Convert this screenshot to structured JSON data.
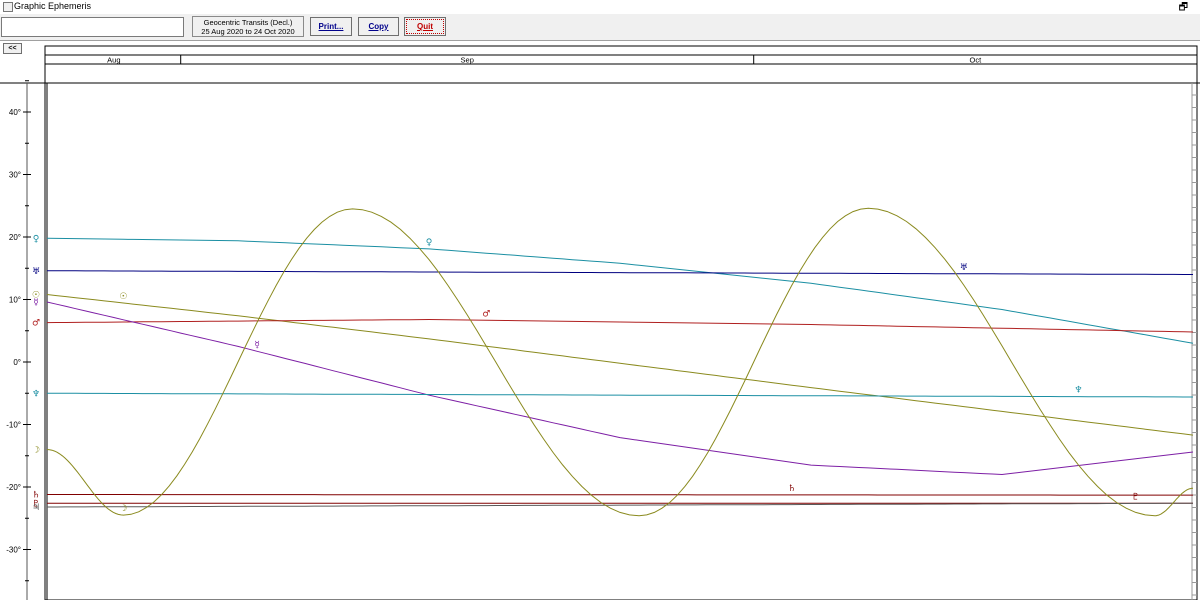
{
  "window": {
    "title": "Graphic Ephemeris"
  },
  "toolbar": {
    "field_value": "",
    "chart_desc_line1": "Geocentric Transits (Decl.)",
    "chart_desc_line2": "25 Aug 2020 to 24 Oct 2020",
    "print_label": "Print...",
    "copy_label": "Copy",
    "quit_label": "Quit",
    "back_label": "<<"
  },
  "chart_data": {
    "type": "line",
    "title": "Geocentric Transits (Decl.)",
    "x_range": [
      "2020-08-25",
      "2020-10-24"
    ],
    "months": [
      "Aug",
      "Sep",
      "Oct"
    ],
    "ylim": [
      -37,
      45
    ],
    "y_ticks": [
      {
        "value": 40,
        "label": "40°"
      },
      {
        "value": 30,
        "label": "30°"
      },
      {
        "value": 20,
        "label": "20°"
      },
      {
        "value": 10,
        "label": "10°"
      },
      {
        "value": 0,
        "label": "0°"
      },
      {
        "value": -10,
        "label": "-10°"
      },
      {
        "value": -20,
        "label": "-20°"
      },
      {
        "value": -30,
        "label": "-30°"
      }
    ],
    "grid": false,
    "series": [
      {
        "name": "Venus",
        "glyph": "♀",
        "color": "#1b8fa3",
        "x": [
          "2020-08-25",
          "2020-09-04",
          "2020-09-14",
          "2020-09-24",
          "2020-10-04",
          "2020-10-14",
          "2020-10-24"
        ],
        "y": [
          19.8,
          19.4,
          18.1,
          15.8,
          12.6,
          8.4,
          3.0
        ]
      },
      {
        "name": "Uranus",
        "glyph": "♅",
        "color": "#000080",
        "x": [
          "2020-08-25",
          "2020-10-24"
        ],
        "y": [
          14.6,
          14.0
        ]
      },
      {
        "name": "Sun",
        "glyph": "☉",
        "color": "#8a8a1e",
        "x": [
          "2020-08-25",
          "2020-09-04",
          "2020-09-14",
          "2020-09-24",
          "2020-10-04",
          "2020-10-14",
          "2020-10-24"
        ],
        "y": [
          10.8,
          7.4,
          3.7,
          -0.2,
          -4.1,
          -7.9,
          -11.7
        ]
      },
      {
        "name": "Mars",
        "glyph": "♂",
        "color": "#b02020",
        "x": [
          "2020-08-25",
          "2020-09-14",
          "2020-10-04",
          "2020-10-24"
        ],
        "y": [
          6.3,
          6.8,
          6.0,
          4.8
        ]
      },
      {
        "name": "Mercury",
        "glyph": "☿",
        "color": "#7d1fa5",
        "x": [
          "2020-08-25",
          "2020-09-04",
          "2020-09-14",
          "2020-09-24",
          "2020-10-04",
          "2020-10-14",
          "2020-10-24"
        ],
        "y": [
          9.6,
          2.5,
          -5.3,
          -12.1,
          -16.5,
          -18.0,
          -14.4
        ]
      },
      {
        "name": "Neptune",
        "glyph": "♆",
        "color": "#1b8fa3",
        "x": [
          "2020-08-25",
          "2020-10-24"
        ],
        "y": [
          -5.0,
          -5.6
        ]
      },
      {
        "name": "Saturn",
        "glyph": "♄",
        "color": "#800000",
        "x": [
          "2020-08-25",
          "2020-10-24"
        ],
        "y": [
          -21.2,
          -21.3
        ]
      },
      {
        "name": "Pluto",
        "glyph": "♇",
        "color": "#800000",
        "x": [
          "2020-08-25",
          "2020-10-24"
        ],
        "y": [
          -22.6,
          -22.6
        ]
      },
      {
        "name": "Jupiter",
        "glyph": "♃",
        "color": "#5a5a5a",
        "x": [
          "2020-08-25",
          "2020-10-24"
        ],
        "y": [
          -23.2,
          -22.6
        ]
      },
      {
        "name": "Moon",
        "glyph": "☽",
        "color": "#8a8a1e",
        "x": [
          "2020-08-25",
          "2020-08-29",
          "2020-09-10",
          "2020-09-25",
          "2020-10-07",
          "2020-10-22",
          "2020-10-24"
        ],
        "y": [
          -14.0,
          -24.5,
          24.5,
          -24.6,
          24.6,
          -24.6,
          -20.2
        ]
      }
    ]
  }
}
